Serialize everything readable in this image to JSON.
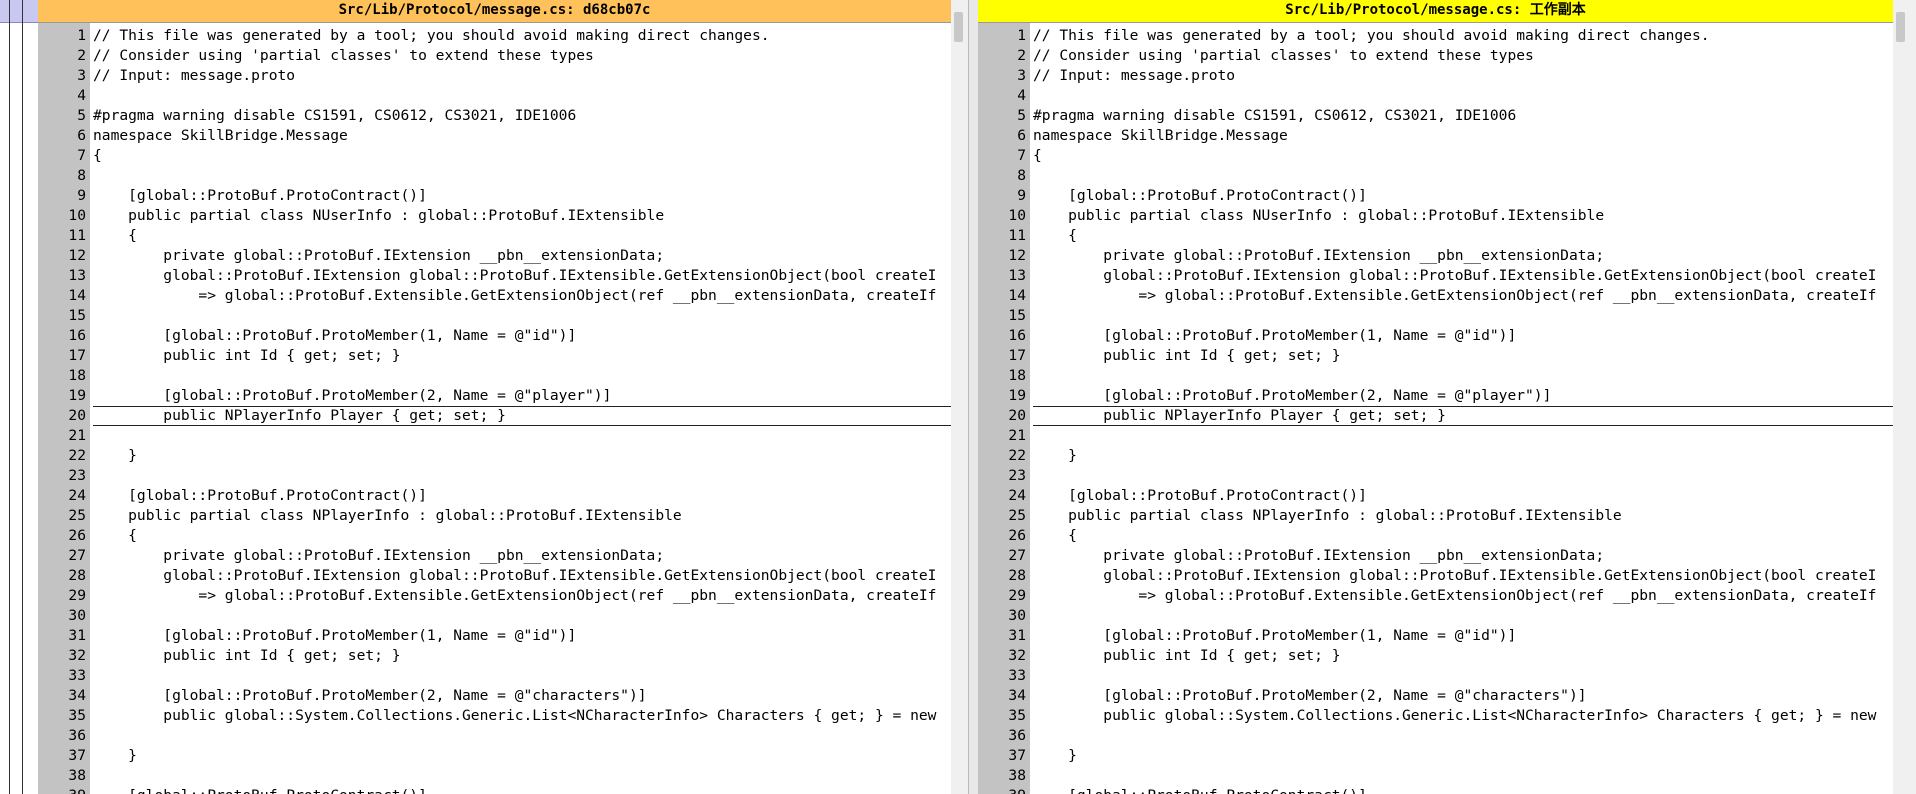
{
  "left": {
    "title": "Src/Lib/Protocol/message.cs: d68cb07c",
    "lines": [
      {
        "n": "1",
        "t": "// This file was generated by a tool; you should avoid making direct changes."
      },
      {
        "n": "2",
        "t": "// Consider using 'partial classes' to extend these types"
      },
      {
        "n": "3",
        "t": "// Input: message.proto"
      },
      {
        "n": "4",
        "t": ""
      },
      {
        "n": "5",
        "t": "#pragma warning disable CS1591, CS0612, CS3021, IDE1006"
      },
      {
        "n": "6",
        "t": "namespace SkillBridge.Message"
      },
      {
        "n": "7",
        "t": "{"
      },
      {
        "n": "8",
        "t": ""
      },
      {
        "n": "9",
        "t": "    [global::ProtoBuf.ProtoContract()]"
      },
      {
        "n": "10",
        "t": "    public partial class NUserInfo : global::ProtoBuf.IExtensible"
      },
      {
        "n": "11",
        "t": "    {"
      },
      {
        "n": "12",
        "t": "        private global::ProtoBuf.IExtension __pbn__extensionData;"
      },
      {
        "n": "13",
        "t": "        global::ProtoBuf.IExtension global::ProtoBuf.IExtensible.GetExtensionObject(bool createI"
      },
      {
        "n": "14",
        "t": "            => global::ProtoBuf.Extensible.GetExtensionObject(ref __pbn__extensionData, createIf"
      },
      {
        "n": "15",
        "t": ""
      },
      {
        "n": "16",
        "t": "        [global::ProtoBuf.ProtoMember(1, Name = @\"id\")]"
      },
      {
        "n": "17",
        "t": "        public int Id { get; set; }"
      },
      {
        "n": "18",
        "t": ""
      },
      {
        "n": "19",
        "t": "        [global::ProtoBuf.ProtoMember(2, Name = @\"player\")]"
      },
      {
        "n": "20",
        "t": "        public NPlayerInfo Player { get; set; }"
      },
      {
        "n": "21",
        "t": ""
      },
      {
        "n": "22",
        "t": "    }"
      },
      {
        "n": "23",
        "t": ""
      },
      {
        "n": "24",
        "t": "    [global::ProtoBuf.ProtoContract()]"
      },
      {
        "n": "25",
        "t": "    public partial class NPlayerInfo : global::ProtoBuf.IExtensible"
      },
      {
        "n": "26",
        "t": "    {"
      },
      {
        "n": "27",
        "t": "        private global::ProtoBuf.IExtension __pbn__extensionData;"
      },
      {
        "n": "28",
        "t": "        global::ProtoBuf.IExtension global::ProtoBuf.IExtensible.GetExtensionObject(bool createI"
      },
      {
        "n": "29",
        "t": "            => global::ProtoBuf.Extensible.GetExtensionObject(ref __pbn__extensionData, createIf"
      },
      {
        "n": "30",
        "t": ""
      },
      {
        "n": "31",
        "t": "        [global::ProtoBuf.ProtoMember(1, Name = @\"id\")]"
      },
      {
        "n": "32",
        "t": "        public int Id { get; set; }"
      },
      {
        "n": "33",
        "t": ""
      },
      {
        "n": "34",
        "t": "        [global::ProtoBuf.ProtoMember(2, Name = @\"characters\")]"
      },
      {
        "n": "35",
        "t": "        public global::System.Collections.Generic.List<NCharacterInfo> Characters { get; } = new"
      },
      {
        "n": "36",
        "t": ""
      },
      {
        "n": "37",
        "t": "    }"
      },
      {
        "n": "38",
        "t": ""
      },
      {
        "n": "39",
        "t": "    [global::ProtoBuf.ProtoContract()]"
      }
    ]
  },
  "right": {
    "title": "Src/Lib/Protocol/message.cs: 工作副本",
    "lines": [
      {
        "n": "1",
        "t": "// This file was generated by a tool; you should avoid making direct changes."
      },
      {
        "n": "2",
        "t": "// Consider using 'partial classes' to extend these types"
      },
      {
        "n": "3",
        "t": "// Input: message.proto"
      },
      {
        "n": "4",
        "t": ""
      },
      {
        "n": "5",
        "t": "#pragma warning disable CS1591, CS0612, CS3021, IDE1006"
      },
      {
        "n": "6",
        "t": "namespace SkillBridge.Message"
      },
      {
        "n": "7",
        "t": "{"
      },
      {
        "n": "8",
        "t": ""
      },
      {
        "n": "9",
        "t": "    [global::ProtoBuf.ProtoContract()]"
      },
      {
        "n": "10",
        "t": "    public partial class NUserInfo : global::ProtoBuf.IExtensible"
      },
      {
        "n": "11",
        "t": "    {"
      },
      {
        "n": "12",
        "t": "        private global::ProtoBuf.IExtension __pbn__extensionData;"
      },
      {
        "n": "13",
        "t": "        global::ProtoBuf.IExtension global::ProtoBuf.IExtensible.GetExtensionObject(bool createI"
      },
      {
        "n": "14",
        "t": "            => global::ProtoBuf.Extensible.GetExtensionObject(ref __pbn__extensionData, createIf"
      },
      {
        "n": "15",
        "t": ""
      },
      {
        "n": "16",
        "t": "        [global::ProtoBuf.ProtoMember(1, Name = @\"id\")]"
      },
      {
        "n": "17",
        "t": "        public int Id { get; set; }"
      },
      {
        "n": "18",
        "t": ""
      },
      {
        "n": "19",
        "t": "        [global::ProtoBuf.ProtoMember(2, Name = @\"player\")]"
      },
      {
        "n": "20",
        "t": "        public NPlayerInfo Player { get; set; }"
      },
      {
        "n": "21",
        "t": ""
      },
      {
        "n": "22",
        "t": "    }"
      },
      {
        "n": "23",
        "t": ""
      },
      {
        "n": "24",
        "t": "    [global::ProtoBuf.ProtoContract()]"
      },
      {
        "n": "25",
        "t": "    public partial class NPlayerInfo : global::ProtoBuf.IExtensible"
      },
      {
        "n": "26",
        "t": "    {"
      },
      {
        "n": "27",
        "t": "        private global::ProtoBuf.IExtension __pbn__extensionData;"
      },
      {
        "n": "28",
        "t": "        global::ProtoBuf.IExtension global::ProtoBuf.IExtensible.GetExtensionObject(bool createI"
      },
      {
        "n": "29",
        "t": "            => global::ProtoBuf.Extensible.GetExtensionObject(ref __pbn__extensionData, createIf"
      },
      {
        "n": "30",
        "t": ""
      },
      {
        "n": "31",
        "t": "        [global::ProtoBuf.ProtoMember(1, Name = @\"id\")]"
      },
      {
        "n": "32",
        "t": "        public int Id { get; set; }"
      },
      {
        "n": "33",
        "t": ""
      },
      {
        "n": "34",
        "t": "        [global::ProtoBuf.ProtoMember(2, Name = @\"characters\")]"
      },
      {
        "n": "35",
        "t": "        public global::System.Collections.Generic.List<NCharacterInfo> Characters { get; } = new"
      },
      {
        "n": "36",
        "t": ""
      },
      {
        "n": "37",
        "t": "    }"
      },
      {
        "n": "38",
        "t": ""
      },
      {
        "n": "39",
        "t": "    [global::ProtoBuf.ProtoContract()]"
      }
    ]
  },
  "highlighted_line": "20",
  "colors": {
    "left_header": "#ffc15a",
    "right_header": "#ffff00",
    "line_number_bar": "#c3c3c3"
  }
}
